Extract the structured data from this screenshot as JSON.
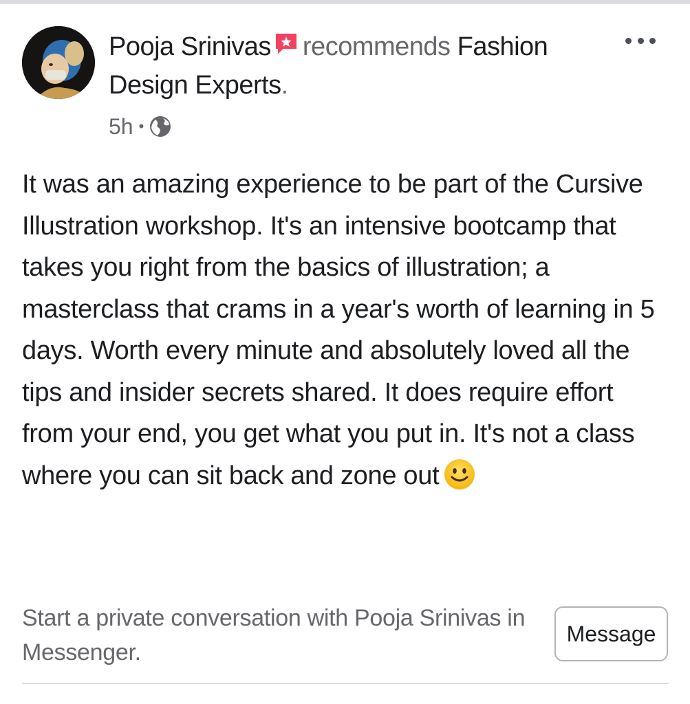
{
  "post": {
    "author": "Pooja Srinivas",
    "verb": "recommends",
    "page_name": "Fashion Design Experts",
    "period": ".",
    "time": "5h",
    "separator": "•",
    "privacy_icon": "globe-icon",
    "badge_icon": "recommendation-badge-icon",
    "more_icon": "more-options-icon",
    "body": "It was an amazing experience to be part of the Cursive Illustration workshop. It's an intensive bootcamp that takes you right from the basics of illustration; a masterclass that crams in a year's worth of learning in 5 days. Worth every minute and absolutely loved all the tips and insider secrets shared. It does require effort from your end, you get what you put in. It's not a class where you can sit back and zone out",
    "emoji": "smiling-face-emoji"
  },
  "messenger": {
    "prompt": "Start a private conversation with Pooja Srinivas in Messenger.",
    "button_label": "Message"
  },
  "colors": {
    "text_primary": "#1c1e21",
    "text_secondary": "#65676b",
    "badge": "#f3425f",
    "divider": "#dadde1"
  }
}
